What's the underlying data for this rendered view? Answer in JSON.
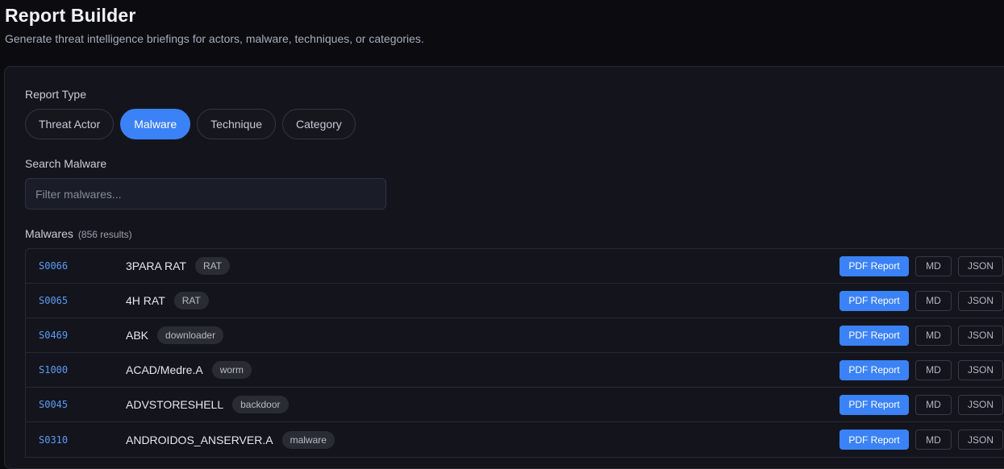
{
  "header": {
    "title": "Report Builder",
    "subtitle": "Generate threat intelligence briefings for actors, malware, techniques, or categories."
  },
  "report_type": {
    "label": "Report Type",
    "options": [
      "Threat Actor",
      "Malware",
      "Technique",
      "Category"
    ],
    "selected": "Malware"
  },
  "search": {
    "label": "Search Malware",
    "placeholder": "Filter malwares...",
    "value": ""
  },
  "results": {
    "label": "Malwares",
    "count_text": "(856 results)",
    "rows": [
      {
        "id": "S0066",
        "name": "3PARA RAT",
        "tag": "RAT"
      },
      {
        "id": "S0065",
        "name": "4H RAT",
        "tag": "RAT"
      },
      {
        "id": "S0469",
        "name": "ABK",
        "tag": "downloader"
      },
      {
        "id": "S1000",
        "name": "ACAD/Medre.A",
        "tag": "worm"
      },
      {
        "id": "S0045",
        "name": "ADVSTORESHELL",
        "tag": "backdoor"
      },
      {
        "id": "S0310",
        "name": "ANDROIDOS_ANSERVER.A",
        "tag": "malware"
      }
    ]
  },
  "actions": {
    "pdf": "PDF Report",
    "md": "MD",
    "json": "JSON"
  },
  "colors": {
    "accent": "#3b82f6",
    "background": "#0b0b10",
    "card": "#14151c"
  }
}
